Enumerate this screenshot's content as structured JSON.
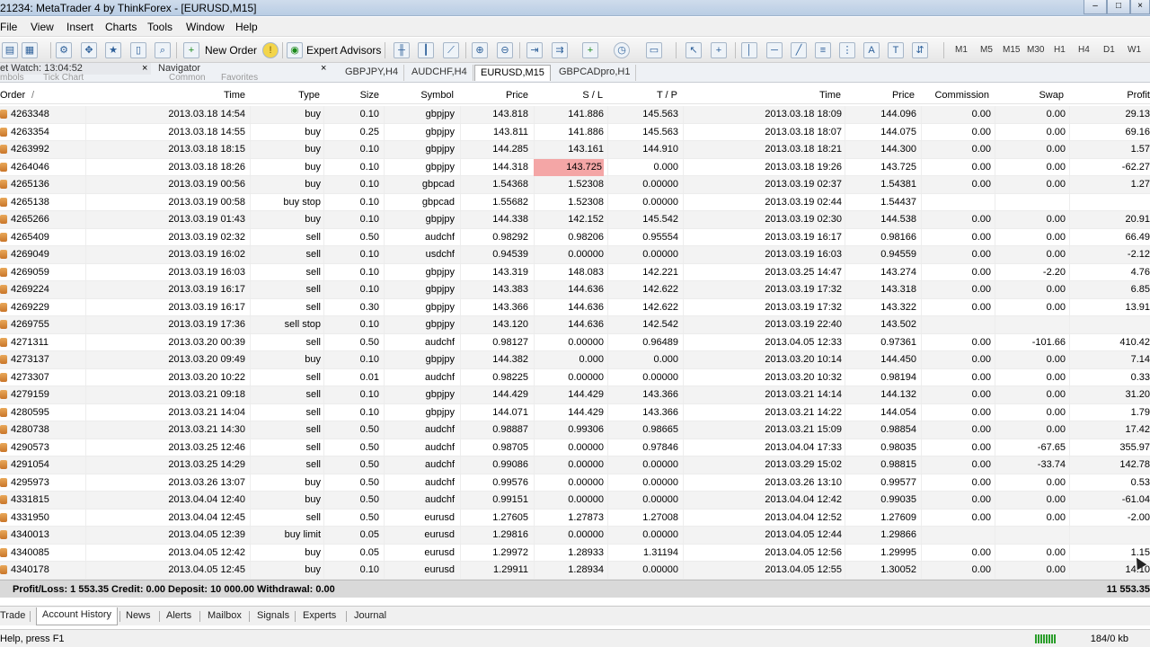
{
  "window": {
    "title": "21234: MetaTrader 4 by ThinkForex - [EURUSD,M15]"
  },
  "menu": [
    "File",
    "View",
    "Insert",
    "Charts",
    "Tools",
    "Window",
    "Help"
  ],
  "toolbar": {
    "new_order": "New Order",
    "expert_advisors": "Expert Advisors",
    "timeframes": [
      "M1",
      "M5",
      "M15",
      "M30",
      "H1",
      "H4",
      "D1",
      "W1"
    ]
  },
  "panels": {
    "market_watch": "et Watch: 13:04:52",
    "navigator": "Navigator",
    "market_watch_tabs": [
      "mbols",
      "Tick Chart"
    ],
    "navigator_tabs": [
      "Common",
      "Favorites"
    ]
  },
  "chart_tabs": [
    "GBPJPY,H4",
    "AUDCHF,H4",
    "EURUSD,M15",
    "GBPCADpro,H1"
  ],
  "table": {
    "headers": [
      "Order",
      "/",
      "Time",
      "Type",
      "Size",
      "Symbol",
      "Price",
      "S / L",
      "T / P",
      "Time",
      "Price",
      "Commission",
      "Swap",
      "Profit"
    ],
    "rows": [
      [
        "4263348",
        "2013.03.18 14:54",
        "buy",
        "0.10",
        "gbpjpy",
        "143.818",
        "141.886",
        "145.563",
        "2013.03.18 18:09",
        "144.096",
        "0.00",
        "0.00",
        "29.13"
      ],
      [
        "4263354",
        "2013.03.18 14:55",
        "buy",
        "0.25",
        "gbpjpy",
        "143.811",
        "141.886",
        "145.563",
        "2013.03.18 18:07",
        "144.075",
        "0.00",
        "0.00",
        "69.16"
      ],
      [
        "4263992",
        "2013.03.18 18:15",
        "buy",
        "0.10",
        "gbpjpy",
        "144.285",
        "143.161",
        "144.910",
        "2013.03.18 18:21",
        "144.300",
        "0.00",
        "0.00",
        "1.57"
      ],
      [
        "4264046",
        "2013.03.18 18:26",
        "buy",
        "0.10",
        "gbpjpy",
        "144.318",
        "143.725",
        "0.000",
        "2013.03.18 19:26",
        "143.725",
        "0.00",
        "0.00",
        "-62.27"
      ],
      [
        "4265136",
        "2013.03.19 00:56",
        "buy",
        "0.10",
        "gbpcad",
        "1.54368",
        "1.52308",
        "0.00000",
        "2013.03.19 02:37",
        "1.54381",
        "0.00",
        "0.00",
        "1.27"
      ],
      [
        "4265138",
        "2013.03.19 00:58",
        "buy stop",
        "0.10",
        "gbpcad",
        "1.55682",
        "1.52308",
        "0.00000",
        "2013.03.19 02:44",
        "1.54437",
        "",
        "",
        ""
      ],
      [
        "4265266",
        "2013.03.19 01:43",
        "buy",
        "0.10",
        "gbpjpy",
        "144.338",
        "142.152",
        "145.542",
        "2013.03.19 02:30",
        "144.538",
        "0.00",
        "0.00",
        "20.91"
      ],
      [
        "4265409",
        "2013.03.19 02:32",
        "sell",
        "0.50",
        "audchf",
        "0.98292",
        "0.98206",
        "0.95554",
        "2013.03.19 16:17",
        "0.98166",
        "0.00",
        "0.00",
        "66.49"
      ],
      [
        "4269049",
        "2013.03.19 16:02",
        "sell",
        "0.10",
        "usdchf",
        "0.94539",
        "0.00000",
        "0.00000",
        "2013.03.19 16:03",
        "0.94559",
        "0.00",
        "0.00",
        "-2.12"
      ],
      [
        "4269059",
        "2013.03.19 16:03",
        "sell",
        "0.10",
        "gbpjpy",
        "143.319",
        "148.083",
        "142.221",
        "2013.03.25 14:47",
        "143.274",
        "0.00",
        "-2.20",
        "4.76"
      ],
      [
        "4269224",
        "2013.03.19 16:17",
        "sell",
        "0.10",
        "gbpjpy",
        "143.383",
        "144.636",
        "142.622",
        "2013.03.19 17:32",
        "143.318",
        "0.00",
        "0.00",
        "6.85"
      ],
      [
        "4269229",
        "2013.03.19 16:17",
        "sell",
        "0.30",
        "gbpjpy",
        "143.366",
        "144.636",
        "142.622",
        "2013.03.19 17:32",
        "143.322",
        "0.00",
        "0.00",
        "13.91"
      ],
      [
        "4269755",
        "2013.03.19 17:36",
        "sell stop",
        "0.10",
        "gbpjpy",
        "143.120",
        "144.636",
        "142.542",
        "2013.03.19 22:40",
        "143.502",
        "",
        "",
        ""
      ],
      [
        "4271311",
        "2013.03.20 00:39",
        "sell",
        "0.50",
        "audchf",
        "0.98127",
        "0.00000",
        "0.96489",
        "2013.04.05 12:33",
        "0.97361",
        "0.00",
        "-101.66",
        "410.42"
      ],
      [
        "4273137",
        "2013.03.20 09:49",
        "buy",
        "0.10",
        "gbpjpy",
        "144.382",
        "0.000",
        "0.000",
        "2013.03.20 10:14",
        "144.450",
        "0.00",
        "0.00",
        "7.14"
      ],
      [
        "4273307",
        "2013.03.20 10:22",
        "sell",
        "0.01",
        "audchf",
        "0.98225",
        "0.00000",
        "0.00000",
        "2013.03.20 10:32",
        "0.98194",
        "0.00",
        "0.00",
        "0.33"
      ],
      [
        "4279159",
        "2013.03.21 09:18",
        "sell",
        "0.10",
        "gbpjpy",
        "144.429",
        "144.429",
        "143.366",
        "2013.03.21 14:14",
        "144.132",
        "0.00",
        "0.00",
        "31.20"
      ],
      [
        "4280595",
        "2013.03.21 14:04",
        "sell",
        "0.10",
        "gbpjpy",
        "144.071",
        "144.429",
        "143.366",
        "2013.03.21 14:22",
        "144.054",
        "0.00",
        "0.00",
        "1.79"
      ],
      [
        "4280738",
        "2013.03.21 14:30",
        "sell",
        "0.50",
        "audchf",
        "0.98887",
        "0.99306",
        "0.98665",
        "2013.03.21 15:09",
        "0.98854",
        "0.00",
        "0.00",
        "17.42"
      ],
      [
        "4290573",
        "2013.03.25 12:46",
        "sell",
        "0.50",
        "audchf",
        "0.98705",
        "0.00000",
        "0.97846",
        "2013.04.04 17:33",
        "0.98035",
        "0.00",
        "-67.65",
        "355.97"
      ],
      [
        "4291054",
        "2013.03.25 14:29",
        "sell",
        "0.50",
        "audchf",
        "0.99086",
        "0.00000",
        "0.00000",
        "2013.03.29 15:02",
        "0.98815",
        "0.00",
        "-33.74",
        "142.78"
      ],
      [
        "4295973",
        "2013.03.26 13:07",
        "buy",
        "0.50",
        "audchf",
        "0.99576",
        "0.00000",
        "0.00000",
        "2013.03.26 13:10",
        "0.99577",
        "0.00",
        "0.00",
        "0.53"
      ],
      [
        "4331815",
        "2013.04.04 12:40",
        "buy",
        "0.50",
        "audchf",
        "0.99151",
        "0.00000",
        "0.00000",
        "2013.04.04 12:42",
        "0.99035",
        "0.00",
        "0.00",
        "-61.04"
      ],
      [
        "4331950",
        "2013.04.04 12:45",
        "sell",
        "0.50",
        "eurusd",
        "1.27605",
        "1.27873",
        "1.27008",
        "2013.04.04 12:52",
        "1.27609",
        "0.00",
        "0.00",
        "-2.00"
      ],
      [
        "4340013",
        "2013.04.05 12:39",
        "buy limit",
        "0.05",
        "eurusd",
        "1.29816",
        "0.00000",
        "0.00000",
        "2013.04.05 12:44",
        "1.29866",
        "",
        "",
        ""
      ],
      [
        "4340085",
        "2013.04.05 12:42",
        "buy",
        "0.05",
        "eurusd",
        "1.29972",
        "1.28933",
        "1.31194",
        "2013.04.05 12:56",
        "1.29995",
        "0.00",
        "0.00",
        "1.15"
      ],
      [
        "4340178",
        "2013.04.05 12:45",
        "buy",
        "0.10",
        "eurusd",
        "1.29911",
        "1.28934",
        "0.00000",
        "2013.04.05 12:55",
        "1.30052",
        "0.00",
        "0.00",
        "14.10"
      ]
    ]
  },
  "summary": {
    "text": "Profit/Loss: 1 553.35  Credit: 0.00  Deposit: 10 000.00  Withdrawal: 0.00",
    "total": "11 553.35"
  },
  "bottom_tabs": [
    "Trade",
    "Account History",
    "News",
    "Alerts",
    "Mailbox",
    "Signals",
    "Experts",
    "Journal"
  ],
  "status": {
    "help": "Help, press F1",
    "traffic": "184/0 kb"
  },
  "colors": {
    "sl_highlight": "#f4a6a6",
    "alt_row": "#f3f3f3"
  }
}
